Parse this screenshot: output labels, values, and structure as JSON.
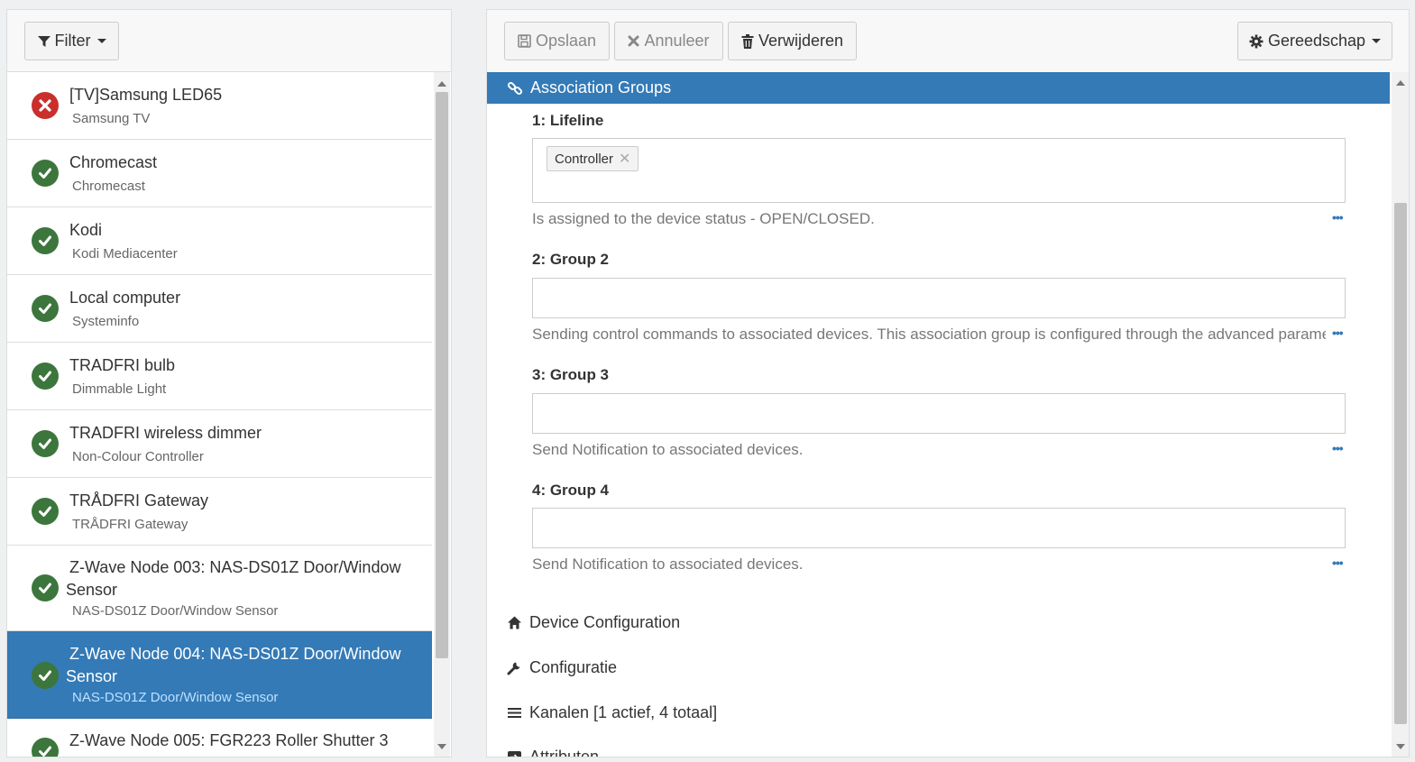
{
  "left_panel": {
    "filter_label": "Filter",
    "things": [
      {
        "name": "[TV]Samsung LED65",
        "type": "Samsung TV",
        "status": "offline"
      },
      {
        "name": "Chromecast",
        "type": "Chromecast",
        "status": "online"
      },
      {
        "name": "Kodi",
        "type": "Kodi Mediacenter",
        "status": "online"
      },
      {
        "name": "Local computer",
        "type": "Systeminfo",
        "status": "online"
      },
      {
        "name": "TRADFRI bulb",
        "type": "Dimmable Light",
        "status": "online"
      },
      {
        "name": "TRADFRI wireless dimmer",
        "type": "Non-Colour Controller",
        "status": "online"
      },
      {
        "name": "TRÅDFRI Gateway",
        "type": "TRÅDFRI Gateway",
        "status": "online"
      },
      {
        "name": "Z-Wave Node 003: NAS-DS01Z Door/Window Sensor",
        "type": "NAS-DS01Z Door/Window Sensor",
        "status": "online"
      },
      {
        "name": "Z-Wave Node 004: NAS-DS01Z Door/Window Sensor",
        "type": "NAS-DS01Z Door/Window Sensor",
        "status": "online",
        "selected": true
      },
      {
        "name": "Z-Wave Node 005: FGR223 Roller Shutter 3",
        "type": "",
        "status": "online"
      }
    ]
  },
  "toolbar": {
    "save_label": "Opslaan",
    "cancel_label": "Annuleer",
    "delete_label": "Verwijderen",
    "tools_label": "Gereedschap"
  },
  "association": {
    "header": "Association Groups",
    "groups": [
      {
        "title": "1: Lifeline",
        "members": [
          "Controller"
        ],
        "description": "Is assigned to the device status - OPEN/CLOSED."
      },
      {
        "title": "2: Group 2",
        "members": [],
        "description": "Sending control commands to associated devices. This association group is configured through the advanced parameters"
      },
      {
        "title": "3: Group 3",
        "members": [],
        "description": "Send Notification to associated devices."
      },
      {
        "title": "4: Group 4",
        "members": [],
        "description": "Send Notification to associated devices."
      }
    ]
  },
  "sections": {
    "device_config": "Device Configuration",
    "configuratie": "Configuratie",
    "kanalen": "Kanalen [1 actief, 4 totaal]",
    "attributen": "Attributen"
  },
  "colors": {
    "selected": "#337ab7",
    "online": "#3c763d",
    "offline": "#c9302c"
  }
}
